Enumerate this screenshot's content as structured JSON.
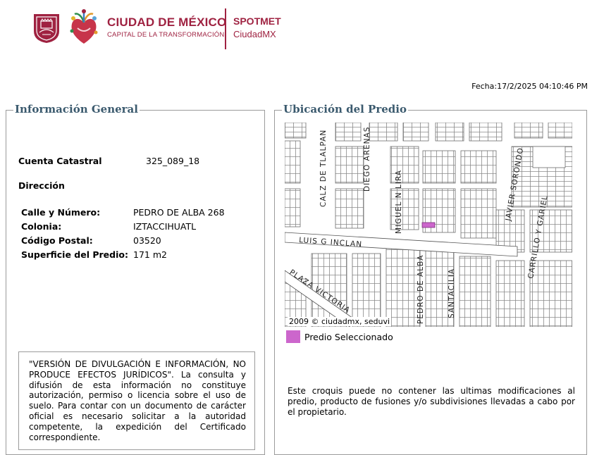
{
  "header": {
    "brand_title": "CIUDAD DE MÉXICO",
    "brand_subtitle": "CAPITAL DE LA TRANSFORMACIÓN",
    "product_title": "SPOTMET",
    "product_subtitle": "CiudadMX",
    "brand_color": "#9f2241",
    "icons": [
      "cdmx-shield-icon",
      "heart-emblem-icon"
    ]
  },
  "fecha": "Fecha:17/2/2025 04:10:46 PM",
  "informacion_general": {
    "title": "Información General",
    "cuenta_label": "Cuenta Catastral",
    "cuenta_value": "325_089_18",
    "direccion_label": "Dirección",
    "fields": [
      {
        "label": "Calle y Número:",
        "value": "PEDRO DE ALBA 268"
      },
      {
        "label": "Colonia:",
        "value": "IZTACCIHUATL"
      },
      {
        "label": "Código Postal:",
        "value": "03520"
      },
      {
        "label": "Superficie del Predio:",
        "value": "171 m2"
      }
    ],
    "disclaimer": "\"VERSIÓN DE DIVULGACIÓN E INFORMACIÓN, NO PRODUCE EFECTOS JURÍDICOS\". La consulta y difusión de esta información no constituye autorización, permiso o licencia sobre el uso de suelo. Para contar con un documento de carácter oficial es necesario solicitar a la autoridad competente, la expedición del Certificado correspondiente."
  },
  "ubicacion": {
    "title": "Ubicación del Predio",
    "street_labels": [
      "CALZ DE TLALPAN",
      "DIEGO ARENAS",
      "MIGUEL N LIRA",
      "JAVIER SORONDO",
      "CARRILLO Y GARIEL",
      "LUIS G INCLAN",
      "PLAZA VICTORIA",
      "PEDRO DE ALBA",
      "SANTACILIA"
    ],
    "credit": "2009 © ciudadmx, seduvi",
    "legend_label": "Predio Seleccionado",
    "selected_color": "#cc66cc",
    "note": "Este croquis puede no contener las ultimas modificaciones al predio, producto de fusiones y/o subdivisiones llevadas a cabo por el propietario."
  }
}
